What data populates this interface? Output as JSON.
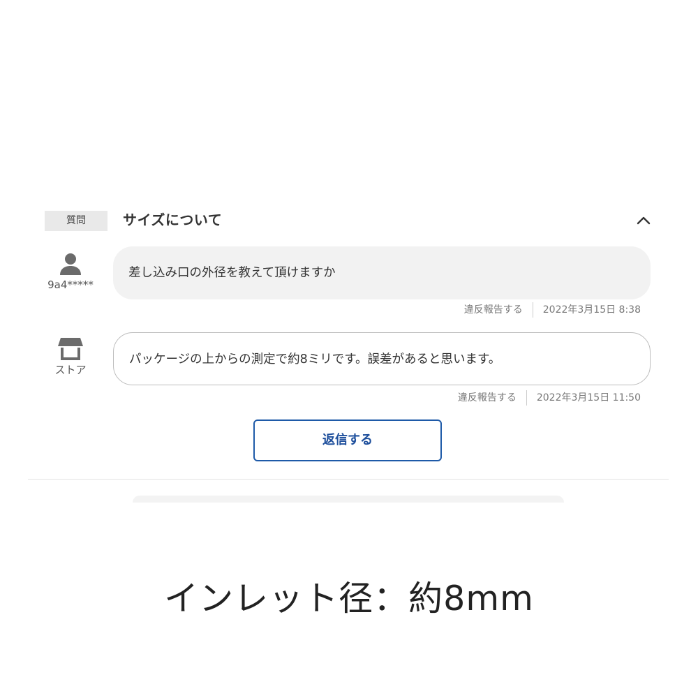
{
  "question_section": {
    "badge_label": "質問",
    "title": "サイズについて",
    "collapse_icon": "chevron-up-icon"
  },
  "messages": [
    {
      "role": "question",
      "author_icon": "user-icon",
      "author_name": "9a4*****",
      "text": "差し込み口の外径を教えて頂けますか",
      "report_label": "違反報告する",
      "timestamp": "2022年3月15日 8:38"
    },
    {
      "role": "answer",
      "author_icon": "store-icon",
      "author_name": "ストア",
      "text": "パッケージの上からの測定で約8ミリです。誤差があると思います。",
      "report_label": "違反報告する",
      "timestamp": "2022年3月15日 11:50"
    }
  ],
  "reply_button_label": "返信する",
  "caption": "インレット径：約8mm",
  "colors": {
    "accent": "#1e5aa8",
    "bubble_question": "#f2f2f2",
    "badge_bg": "#e9e9e9",
    "icon_gray": "#6b6b6b"
  }
}
